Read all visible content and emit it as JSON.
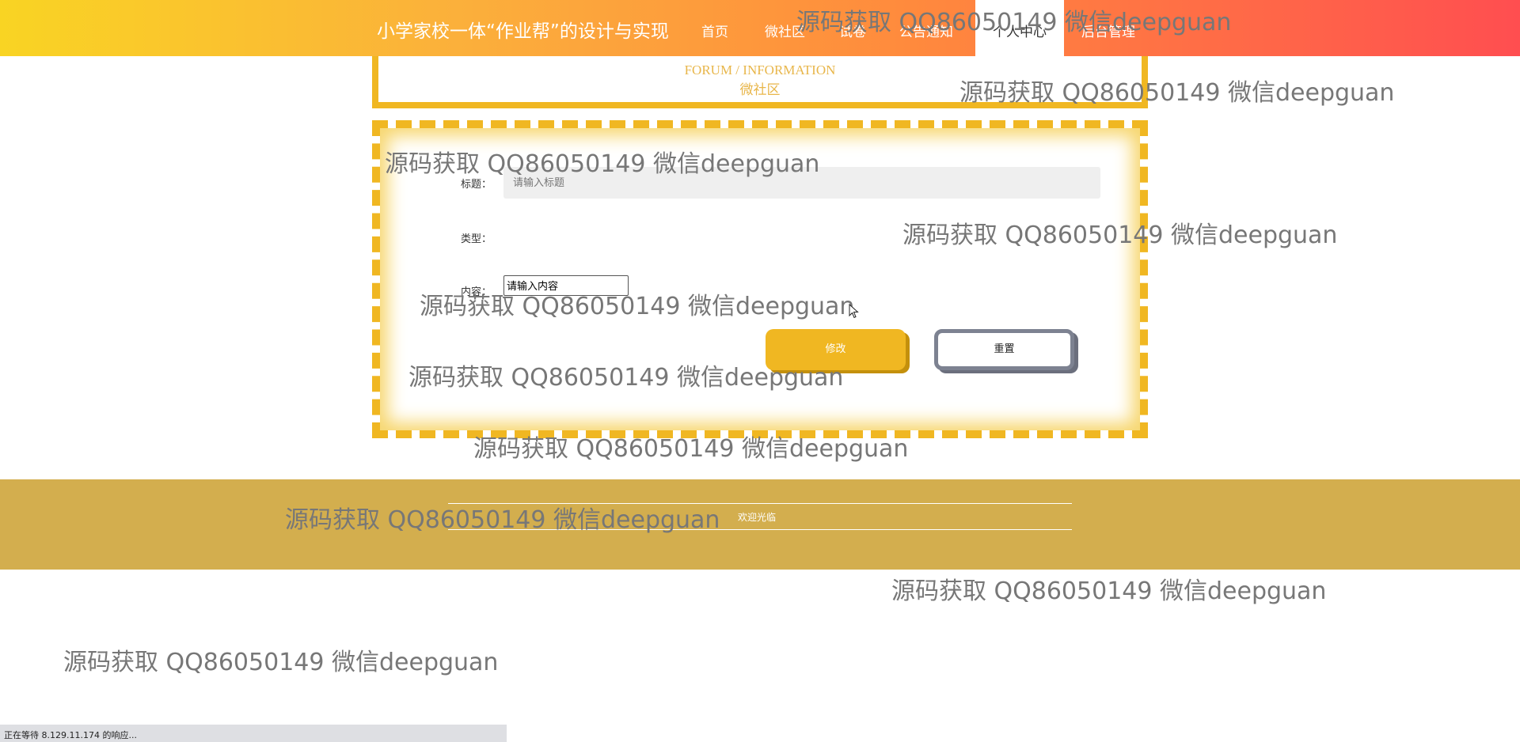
{
  "header": {
    "site_title": "小学家校一体“作业帮”的设计与实现",
    "nav": [
      {
        "label": "首页",
        "active": false
      },
      {
        "label": "微社区",
        "active": false
      },
      {
        "label": "试卷",
        "active": false
      },
      {
        "label": "公告通知",
        "active": false
      },
      {
        "label": "个人中心",
        "active": true
      },
      {
        "label": "后台管理",
        "active": false
      }
    ]
  },
  "page_heading": {
    "en": "FORUM / INFORMATION",
    "cn": "微社区"
  },
  "form": {
    "title_label": "标题：",
    "title_placeholder": "请输入标题",
    "type_label": "类型：",
    "content_label": "内容：",
    "content_placeholder": "请输入内容",
    "submit_label": "修改",
    "reset_label": "重置"
  },
  "footer": {
    "text": "欢迎光临"
  },
  "watermark_text": "源码获取 QQ86050149 微信deepguan",
  "status_bar": "正在等待 8.129.11.174 的响应...",
  "colors": {
    "accent": "#f0b722",
    "footer_bg": "#d3ae4e",
    "header_gradient_start": "#f9d423",
    "header_gradient_end": "#ff4e50",
    "reset_border": "#7d8291"
  }
}
